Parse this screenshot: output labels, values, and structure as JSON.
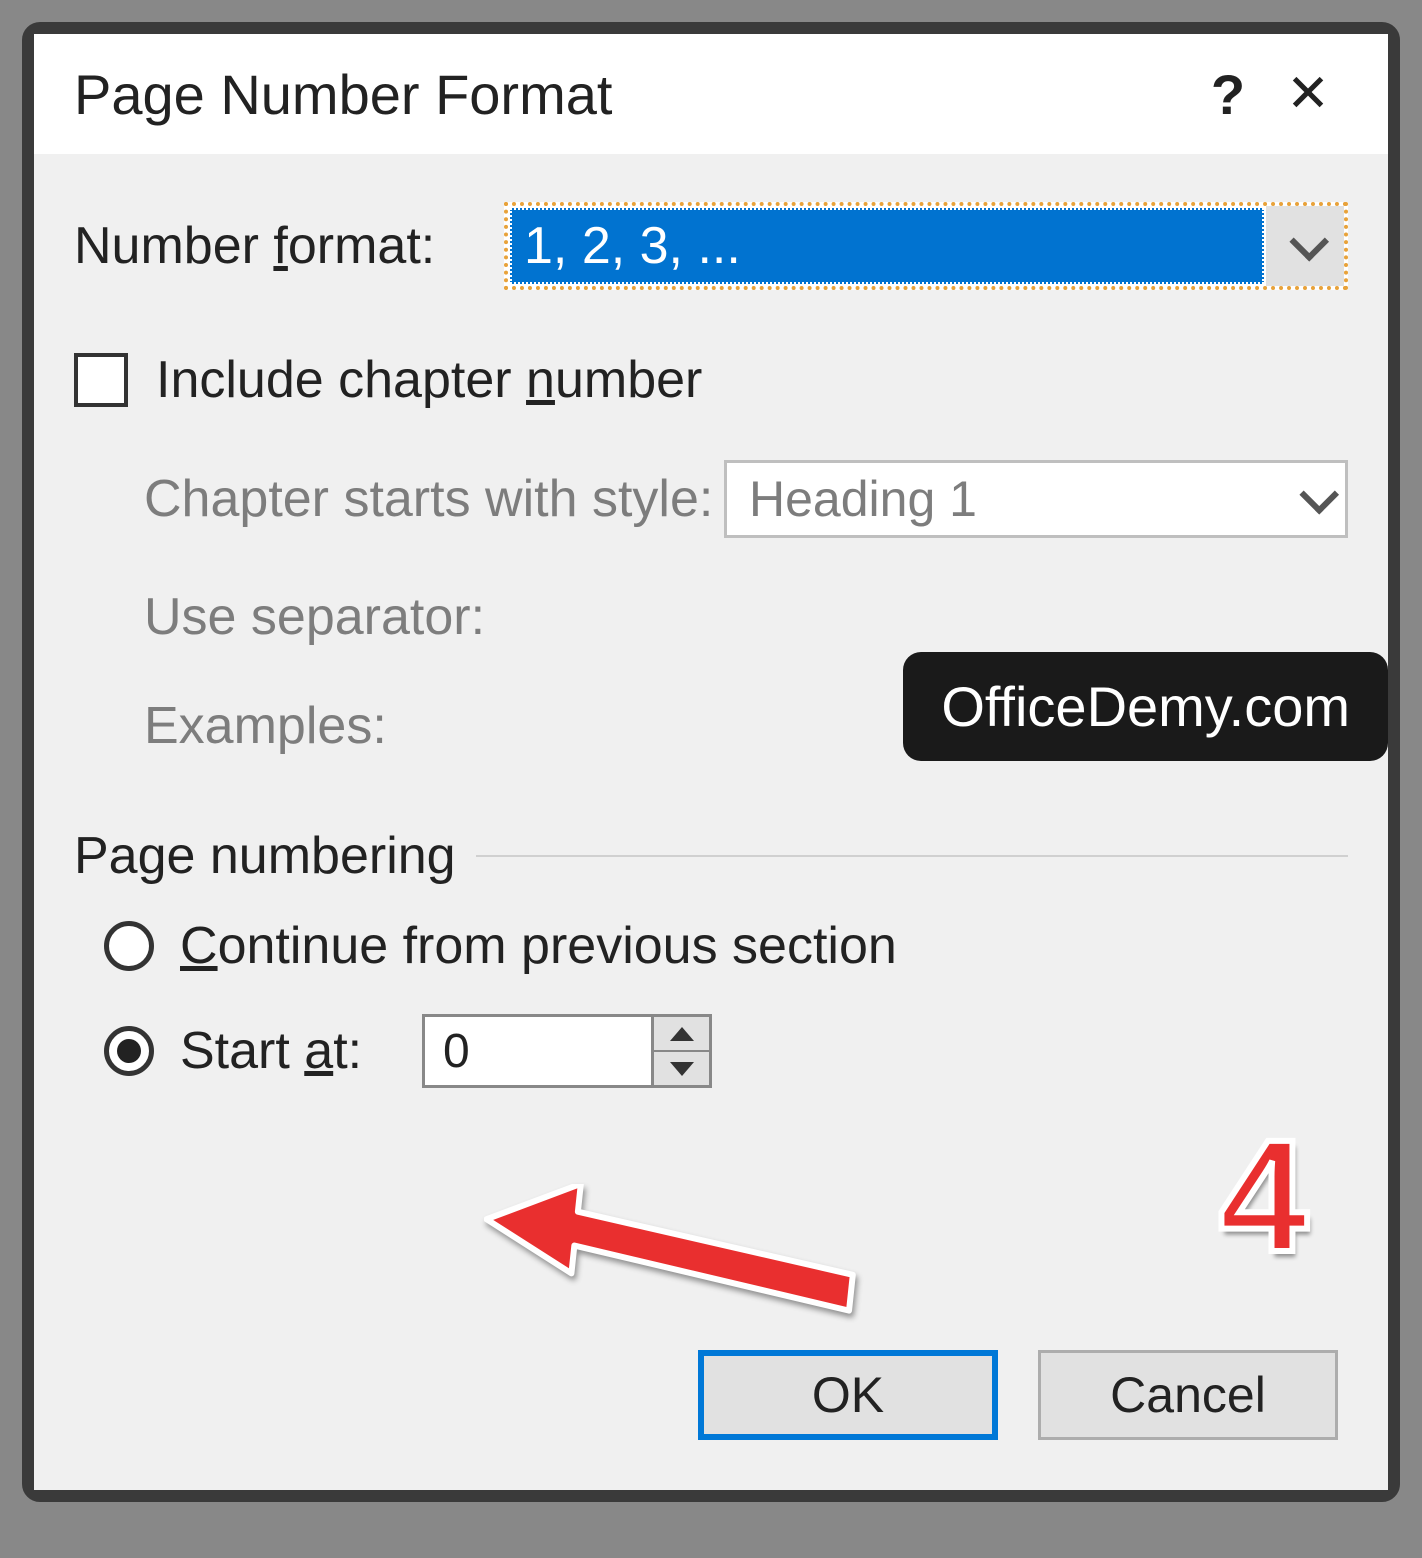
{
  "titlebar": {
    "title": "Page Number Format",
    "help": "?",
    "close": "✕"
  },
  "format": {
    "label_pre": "Number ",
    "label_u": "f",
    "label_post": "ormat:",
    "selected": "1, 2, 3, ..."
  },
  "chapter": {
    "checkbox_label_pre": "Include chapter ",
    "checkbox_label_u": "n",
    "checkbox_label_post": "umber",
    "style_label": "Chapter starts with style:",
    "style_value": "Heading 1",
    "separator_label": "Use separator:",
    "examples_label": "Examples:"
  },
  "watermark": "OfficeDemy.com",
  "page_numbering": {
    "section_title": "Page numbering",
    "continue_u": "C",
    "continue_post": "ontinue from previous section",
    "start_pre": "Start ",
    "start_u": "a",
    "start_post": "t:",
    "start_value": "0"
  },
  "annotation": {
    "number": "4"
  },
  "buttons": {
    "ok": "OK",
    "cancel": "Cancel"
  }
}
